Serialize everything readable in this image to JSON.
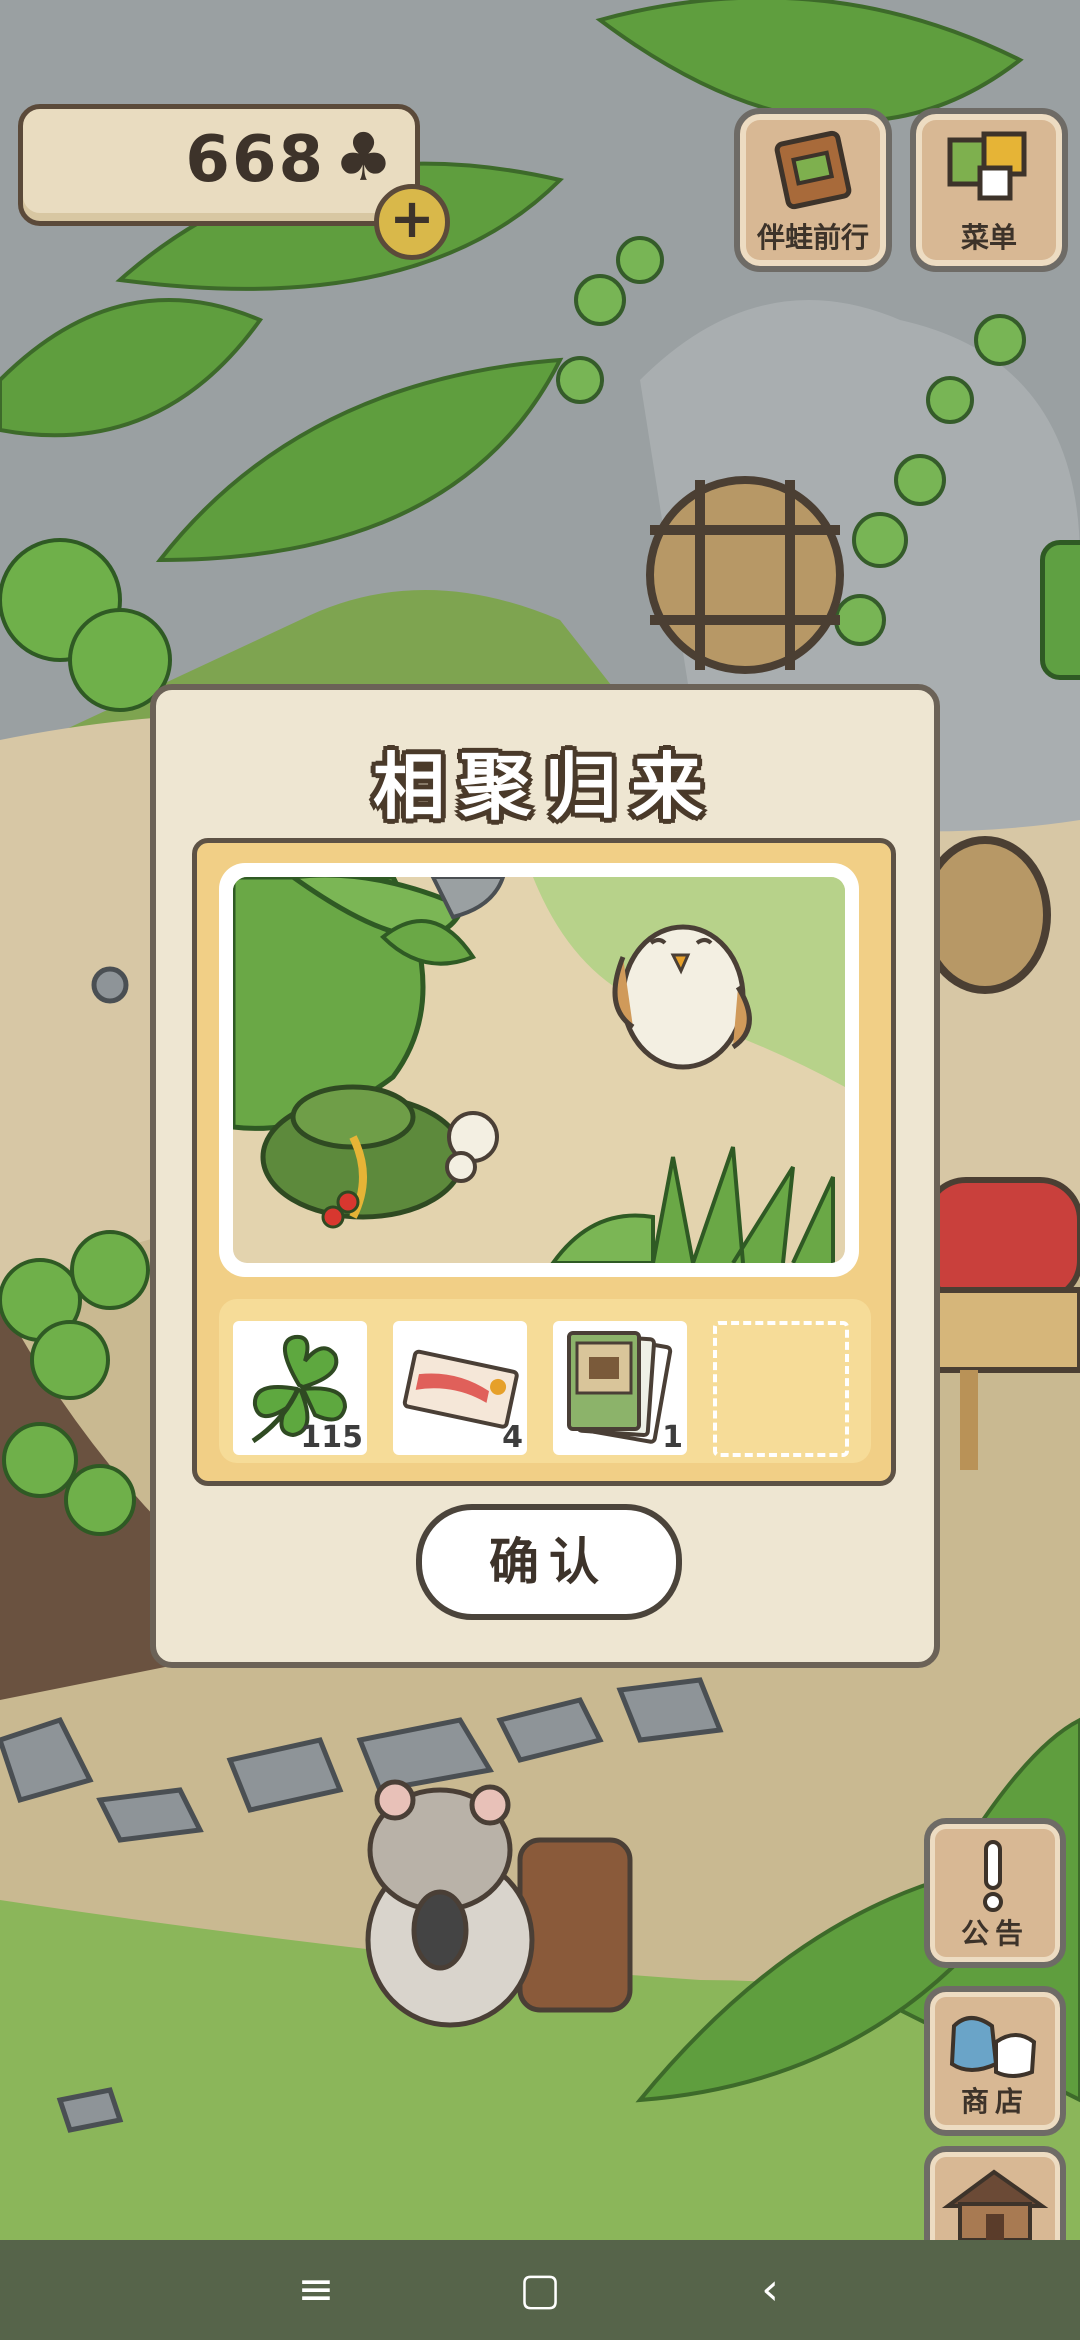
{
  "hud": {
    "clover_count": "668",
    "clover_icon": "clover-icon",
    "buttons": {
      "travel_with_frog": "伴蛙前行",
      "menu": "菜单"
    }
  },
  "dialog": {
    "title": "相聚归来",
    "rewards": [
      {
        "item": "clover",
        "count": "115"
      },
      {
        "item": "ticket",
        "count": "4"
      },
      {
        "item": "card-pack",
        "count": "1"
      },
      {
        "item": "empty",
        "count": ""
      }
    ],
    "confirm_label": "确认"
  },
  "side_buttons": {
    "notice": "公告",
    "shop": "商店",
    "house": "小屋"
  },
  "nav": {
    "menu_icon": "≡",
    "home_icon": "▢",
    "back_icon": "‹"
  }
}
